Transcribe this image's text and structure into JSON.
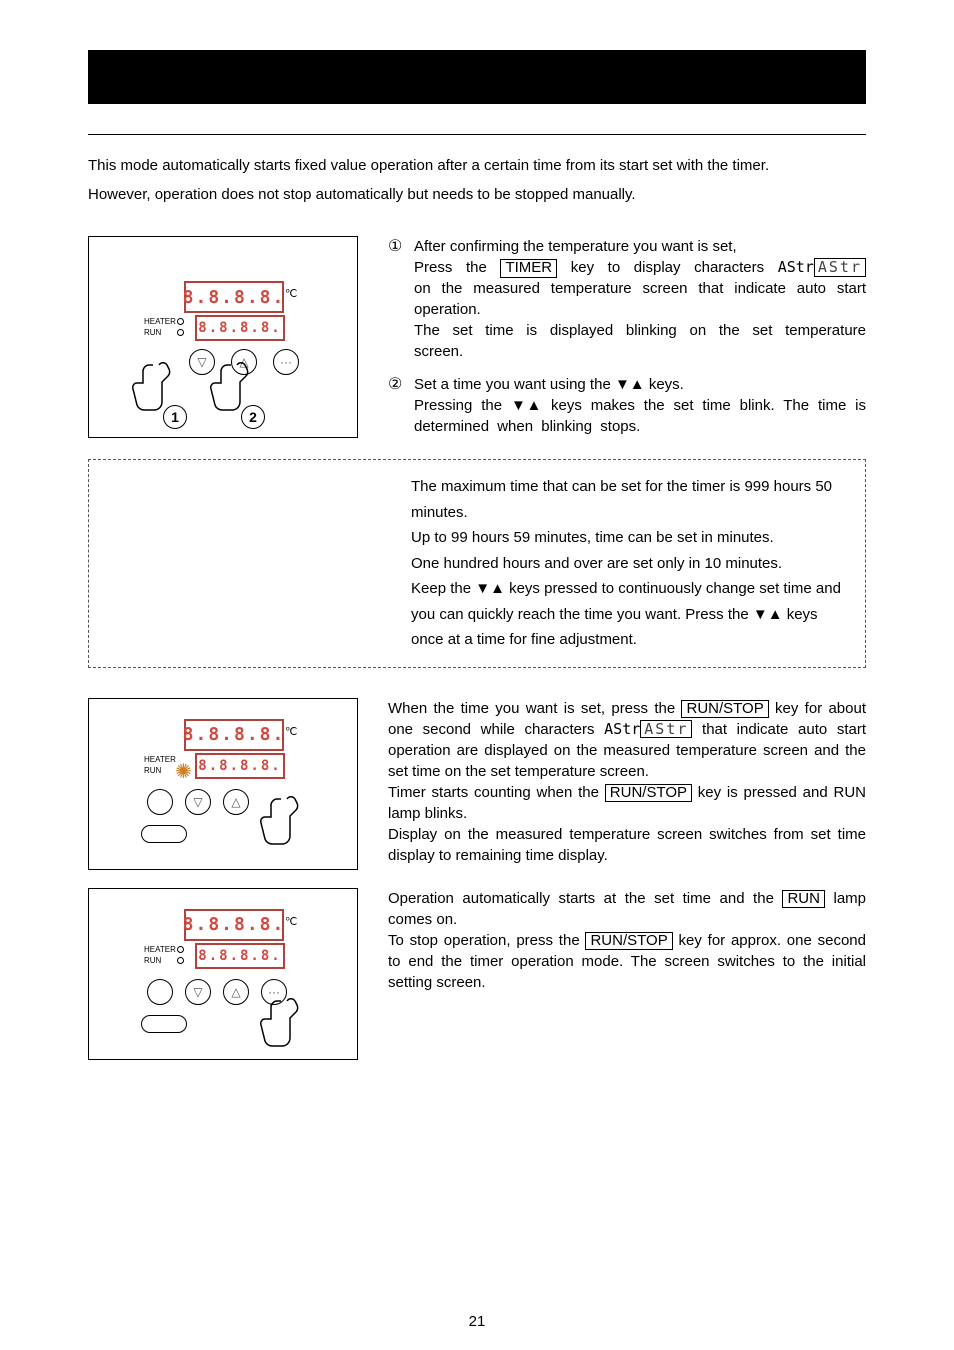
{
  "intro": {
    "p1": "This mode automatically starts fixed value operation after a certain time from its start set with the timer.",
    "p2": "However, operation does not stop automatically but needs to be stopped manually."
  },
  "illu": {
    "seg": "8.8.8.8.",
    "heater_label": "HEATER",
    "run_label": "RUN",
    "degc": "℃"
  },
  "step1": {
    "num": "①",
    "line1": "After confirming the temperature you want is set,",
    "line2a": "Press the ",
    "timer_key": "TIMER",
    "line2b": " key to display characters ",
    "astr_word": "AStr",
    "seg_text": "AStr",
    "line2c": " on the measured temperature screen that indicate auto start operation.",
    "line3": "The set time is displayed blinking on the set temperature screen."
  },
  "step2": {
    "num": "②",
    "line1a": "Set a time you want using the ",
    "keys": "▼▲",
    "line1b": " keys.",
    "line2a": "Pressing the ",
    "line2b": " keys makes the set time blink. The time is determined when blinking stops."
  },
  "note": {
    "l1": "The maximum time that can be set for the timer is 999 hours 50 minutes.",
    "l2": "Up to 99 hours 59 minutes, time can be set in minutes.",
    "l3": "One hundred hours and over are set only in 10 minutes.",
    "l4a": "Keep the ",
    "l4b": " keys pressed to continuously change set time and you can quickly reach the time you want. Press the ",
    "l4c": " keys once at a time for fine adjustment."
  },
  "block3": {
    "t1a": "When the time you want is set, press the ",
    "runstop": "RUN/STOP",
    "t1b": " key for about one second while characters ",
    "astr_word": "AStr",
    "seg_text": "AStr",
    "t1c": " that indicate auto start operation are displayed on the measured temperature screen and the set time on the set temperature screen.",
    "t2a": "Timer starts counting when the ",
    "t2b": " key is pressed and RUN lamp blinks.",
    "t3": "Display on the measured temperature screen switches from set time display to remaining time display."
  },
  "block4": {
    "t1a": "Operation automatically starts at the set time and the ",
    "run": "RUN",
    "t1b": " lamp comes on.",
    "t2a": "To stop operation, press the ",
    "t2b": " key for approx. one second to end the timer operation mode. The screen switches to the initial setting screen."
  },
  "page_number": "21"
}
